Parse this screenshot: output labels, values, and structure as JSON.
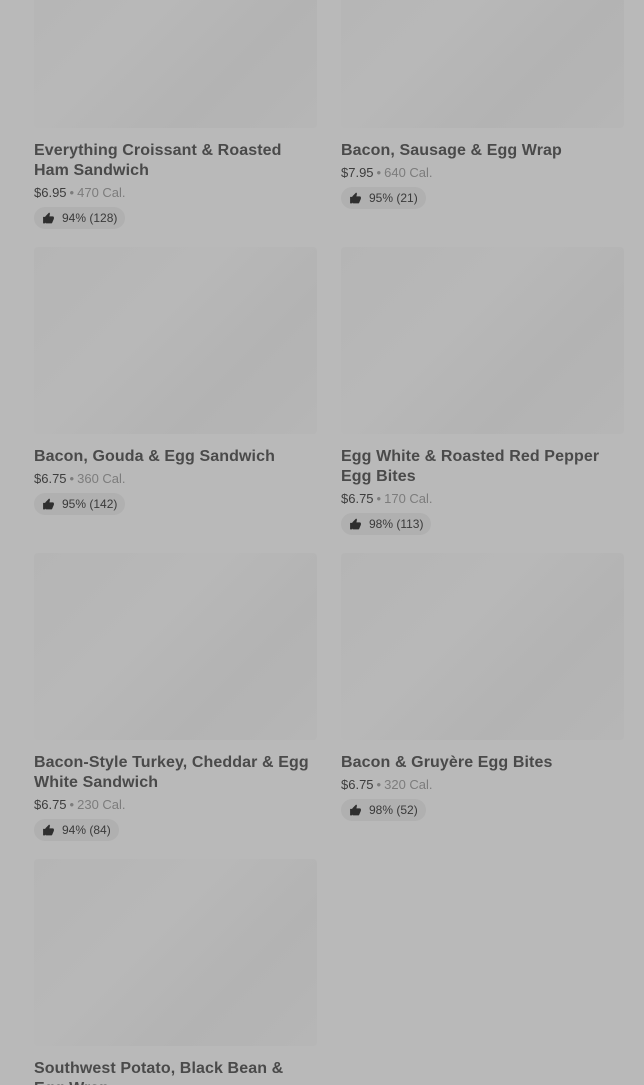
{
  "items": [
    {
      "name": "Everything Croissant & Roasted Ham Sandwich",
      "price": "$6.95",
      "calories": "470 Cal.",
      "rating": "94% (128)"
    },
    {
      "name": "Bacon, Sausage & Egg Wrap",
      "price": "$7.95",
      "calories": "640 Cal.",
      "rating": "95% (21)"
    },
    {
      "name": "Bacon, Gouda & Egg Sandwich",
      "price": "$6.75",
      "calories": "360 Cal.",
      "rating": "95% (142)"
    },
    {
      "name": "Egg White & Roasted Red Pepper Egg Bites",
      "price": "$6.75",
      "calories": "170 Cal.",
      "rating": "98% (113)"
    },
    {
      "name": "Bacon-Style Turkey, Cheddar & Egg White Sandwich",
      "price": "$6.75",
      "calories": "230 Cal.",
      "rating": "94% (84)"
    },
    {
      "name": "Bacon & Gruyère Egg Bites",
      "price": "$6.75",
      "calories": "320 Cal.",
      "rating": "98% (52)"
    },
    {
      "name": "Southwest Potato, Black Bean & Egg Wrap",
      "price": "",
      "calories": "",
      "rating": ""
    }
  ],
  "separator": "•",
  "icons": {
    "rating": "thumbs-up-icon"
  }
}
